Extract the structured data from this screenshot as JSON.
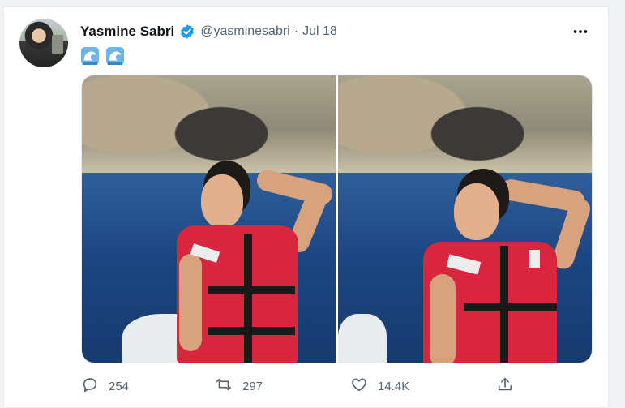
{
  "tweet": {
    "author_name": "Yasmine Sabri",
    "handle": "@yasminesabri",
    "separator": "·",
    "date": "Jul 18",
    "text_emojis": [
      "wave-emoji",
      "wave-emoji"
    ],
    "more_icon": "more-dots-icon",
    "verified_color": "#1d9bf0"
  },
  "actions": {
    "reply_count": "254",
    "retweet_count": "297",
    "like_count": "14.4K"
  },
  "colors": {
    "text_primary": "#0f1419",
    "text_secondary": "#536471",
    "accent": "#1d9bf0",
    "vest_red": "#d7263d"
  }
}
